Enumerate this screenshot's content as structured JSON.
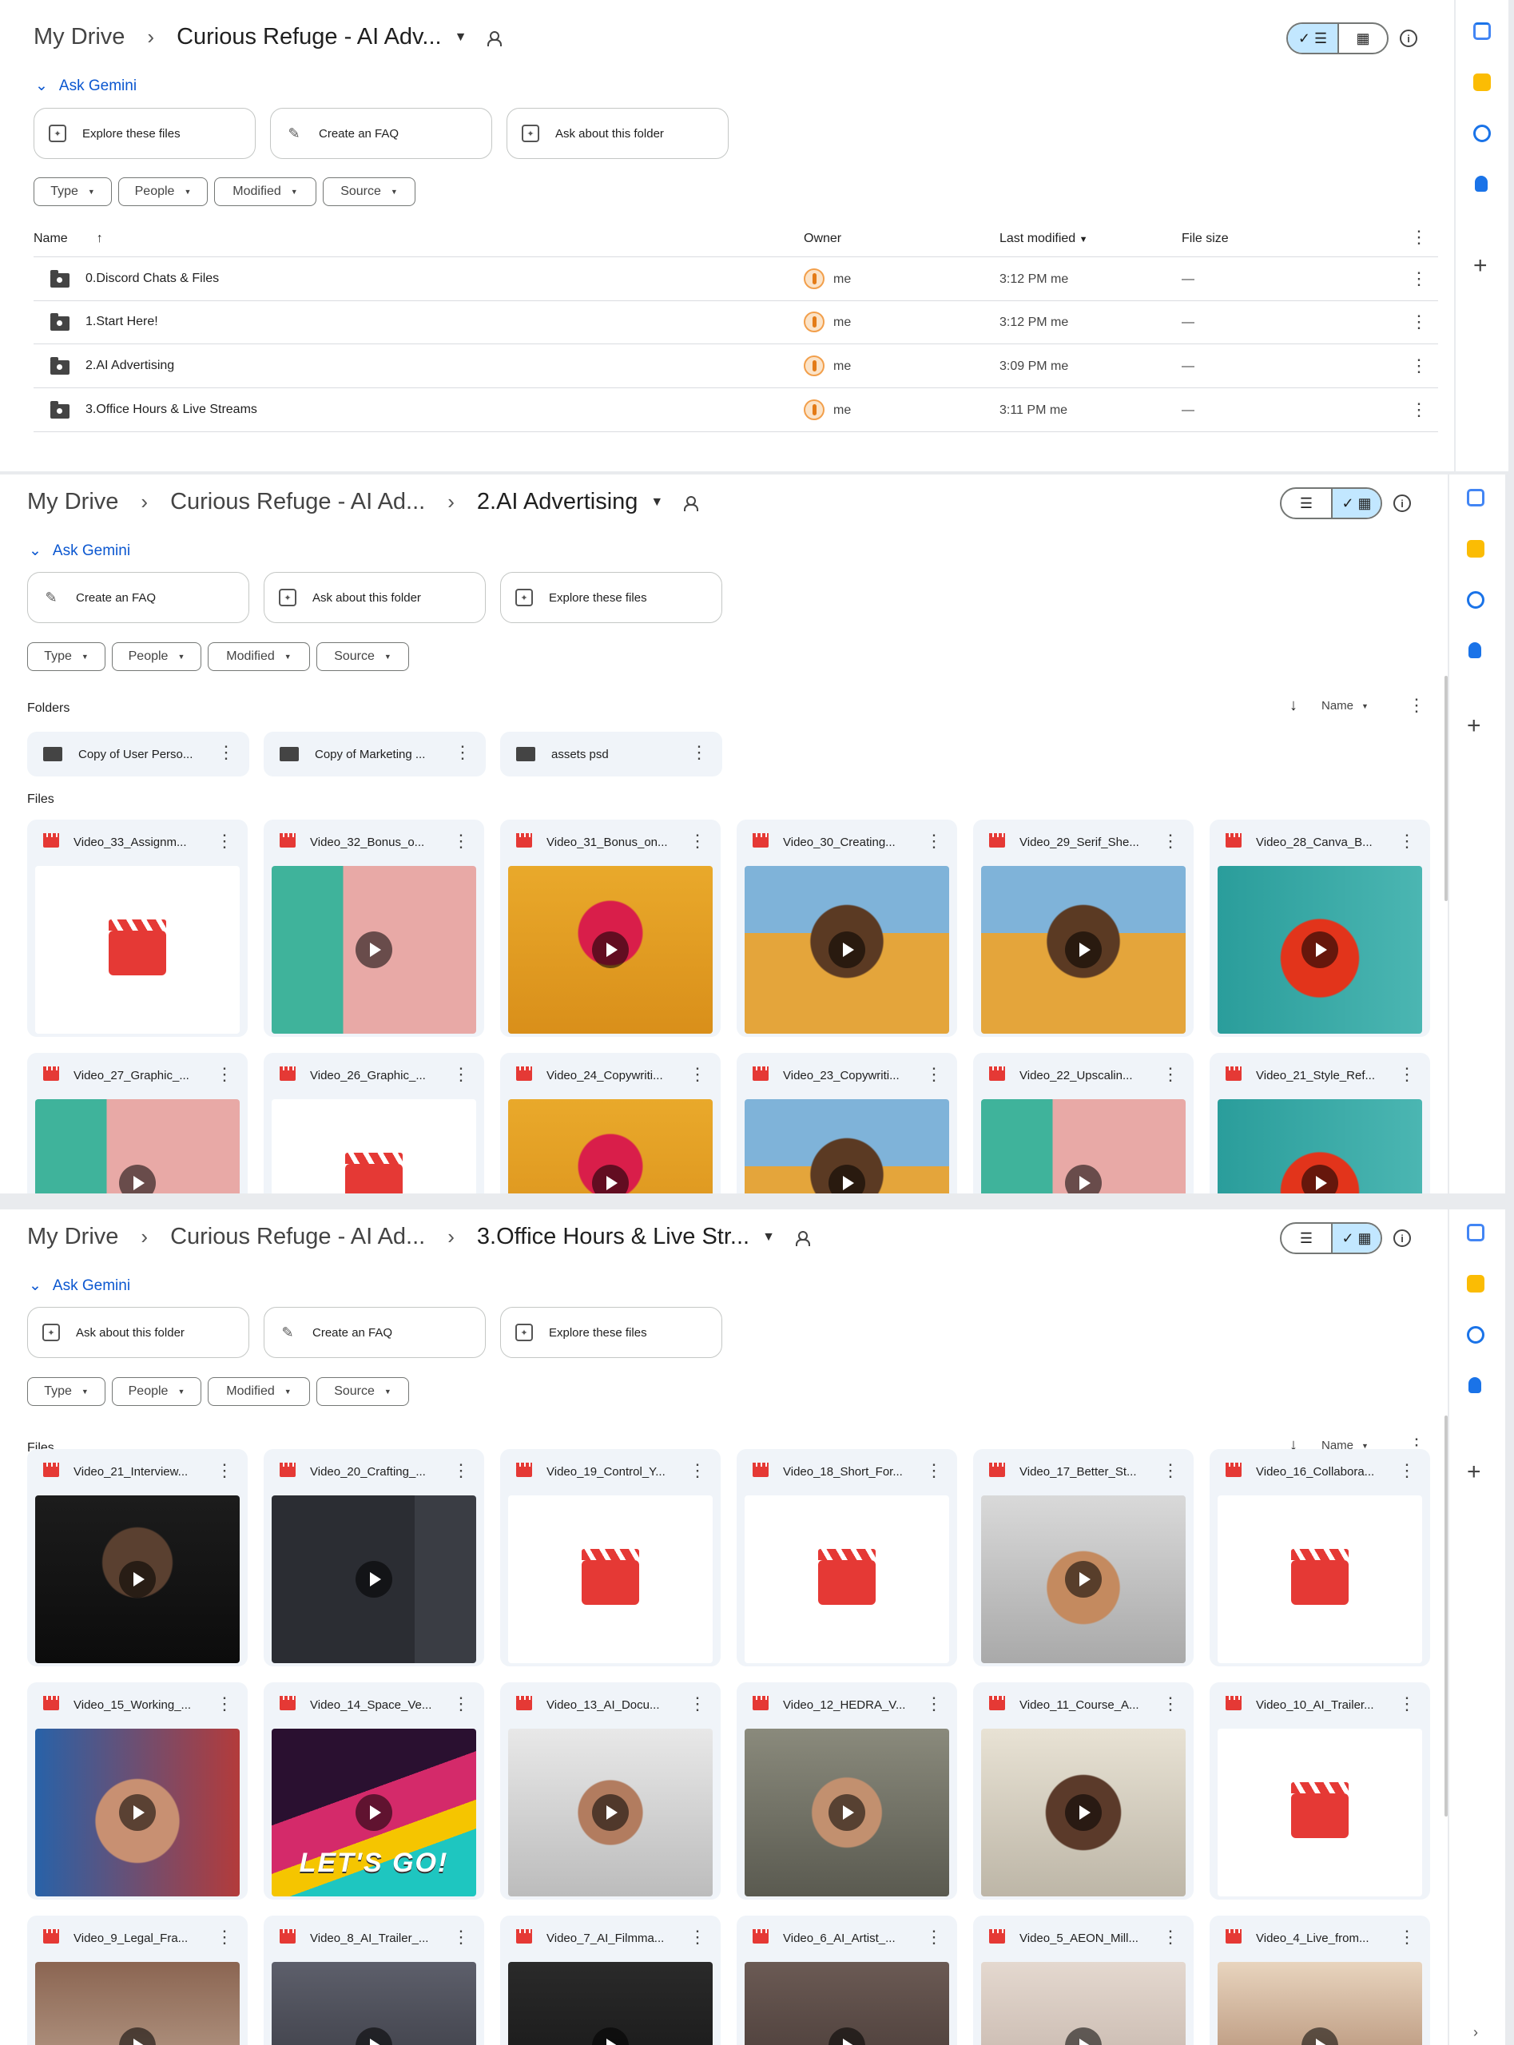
{
  "panel1": {
    "breadcrumb": [
      "My Drive",
      "Curious Refuge - AI Adv..."
    ],
    "ask_gemini": "Ask Gemini",
    "chips": [
      "Explore these files",
      "Create an FAQ",
      "Ask about this folder"
    ],
    "filters": [
      "Type",
      "People",
      "Modified",
      "Source"
    ],
    "columns": {
      "name": "Name",
      "owner": "Owner",
      "modified": "Last modified",
      "size": "File size"
    },
    "rows": [
      {
        "name": "0.Discord Chats & Files",
        "owner": "me",
        "modified": "3:12 PM  me",
        "size": "—"
      },
      {
        "name": "1.Start Here!",
        "owner": "me",
        "modified": "3:12 PM  me",
        "size": "—"
      },
      {
        "name": "2.AI Advertising",
        "owner": "me",
        "modified": "3:09 PM  me",
        "size": "—"
      },
      {
        "name": "3.Office Hours & Live Streams",
        "owner": "me",
        "modified": "3:11 PM  me",
        "size": "—"
      }
    ]
  },
  "panel2": {
    "breadcrumb": [
      "My Drive",
      "Curious Refuge - AI Ad...",
      "2.AI Advertising"
    ],
    "ask_gemini": "Ask Gemini",
    "chips": [
      "Create an FAQ",
      "Ask about this folder",
      "Explore these files"
    ],
    "filters": [
      "Type",
      "People",
      "Modified",
      "Source"
    ],
    "folders_label": "Folders",
    "files_label": "Files",
    "sort_label": "Name",
    "folders": [
      "Copy of User Perso...",
      "Copy of Marketing ...",
      "assets psd"
    ],
    "files": [
      "Video_33_Assignm...",
      "Video_32_Bonus_o...",
      "Video_31_Bonus_on...",
      "Video_30_Creating...",
      "Video_29_Serif_She...",
      "Video_28_Canva_B...",
      "Video_27_Graphic_...",
      "Video_26_Graphic_...",
      "Video_24_Copywriti...",
      "Video_23_Copywriti...",
      "Video_22_Upscalin...",
      "Video_21_Style_Ref..."
    ]
  },
  "panel3": {
    "breadcrumb": [
      "My Drive",
      "Curious Refuge - AI Ad...",
      "3.Office Hours & Live Str..."
    ],
    "ask_gemini": "Ask Gemini",
    "chips": [
      "Ask about this folder",
      "Create an FAQ",
      "Explore these files"
    ],
    "filters": [
      "Type",
      "People",
      "Modified",
      "Source"
    ],
    "files_label": "Files",
    "sort_label": "Name",
    "files": [
      "Video_21_Interview...",
      "Video_20_Crafting_...",
      "Video_19_Control_Y...",
      "Video_18_Short_For...",
      "Video_17_Better_St...",
      "Video_16_Collabora...",
      "Video_15_Working_...",
      "Video_14_Space_Ve...",
      "Video_13_AI_Docu...",
      "Video_12_HEDRA_V...",
      "Video_11_Course_A...",
      "Video_10_AI_Trailer...",
      "Video_9_Legal_Fra...",
      "Video_8_AI_Trailer_...",
      "Video_7_AI_Filmma...",
      "Video_6_AI_Artist_...",
      "Video_5_AEON_Mill...",
      "Video_4_Live_from..."
    ],
    "thumb_caption": "LET'S GO!"
  },
  "icons": {
    "folder": "shared-folder-icon",
    "video": "video-file-icon",
    "more": "more-vert-icon",
    "play": "play-icon",
    "clapper": "clapperboard-icon"
  },
  "colors": {
    "accent": "#0b57d0",
    "selected": "#c2e7ff",
    "video_red": "#e53935",
    "tile_bg": "#f0f4f9"
  }
}
